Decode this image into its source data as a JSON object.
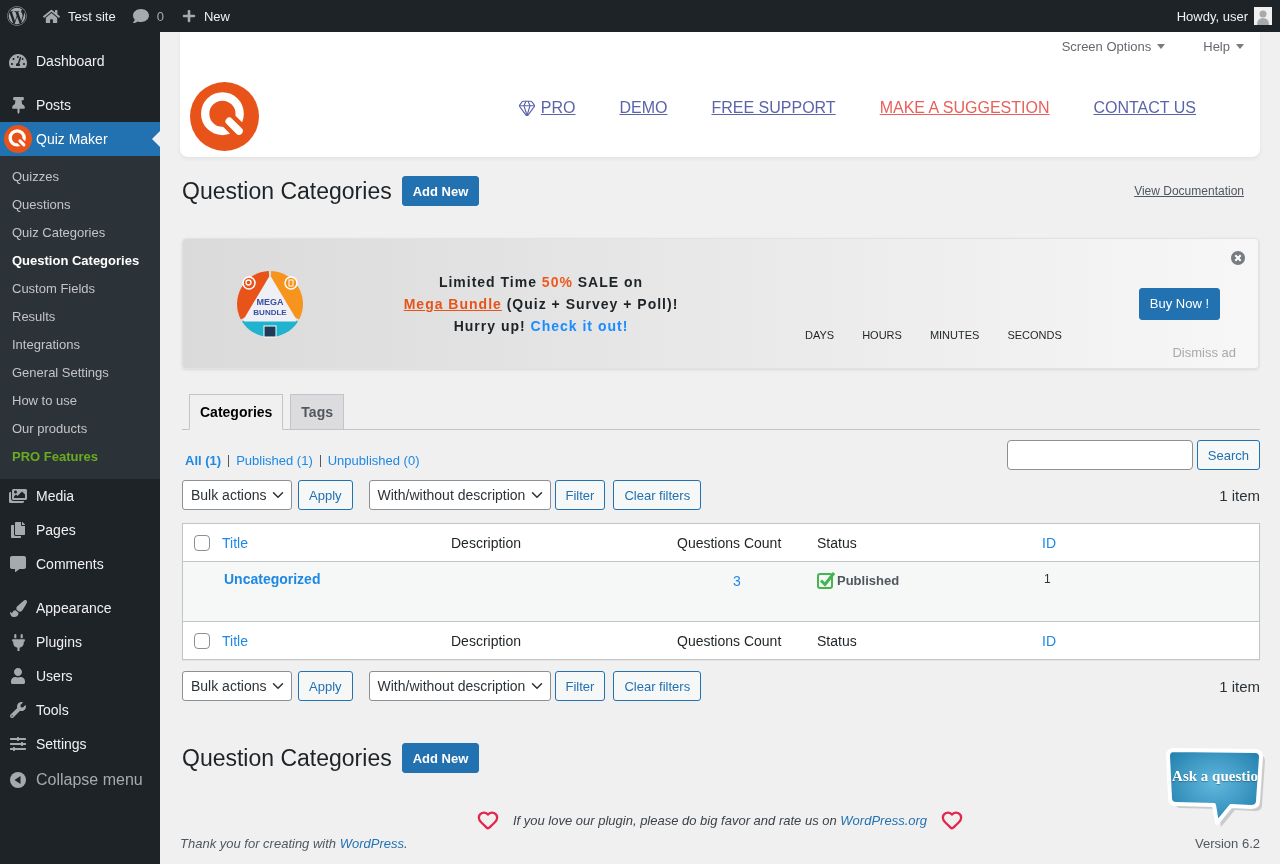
{
  "admin_bar": {
    "site_name": "Test site",
    "comment_count": "0",
    "new_label": "New",
    "greeting": "Howdy, user"
  },
  "sidebar": {
    "sections": [
      {
        "items": [
          {
            "label": "Dashboard",
            "selected": false
          }
        ]
      },
      {
        "items": [
          {
            "label": "Posts",
            "selected": false
          },
          {
            "label": "Quiz Maker",
            "selected": true,
            "children": [
              {
                "label": "Quizzes",
                "selected": false
              },
              {
                "label": "Questions",
                "selected": false
              },
              {
                "label": "Quiz Categories",
                "selected": false
              },
              {
                "label": "Question Categories",
                "selected": true
              },
              {
                "label": "Custom Fields",
                "selected": false
              },
              {
                "label": "Results",
                "selected": false
              },
              {
                "label": "Integrations",
                "selected": false
              },
              {
                "label": "General Settings",
                "selected": false
              },
              {
                "label": "How to use",
                "selected": false
              },
              {
                "label": "Our products",
                "selected": false
              },
              {
                "label": "PRO Features",
                "selected": false,
                "kind": "pro"
              }
            ]
          },
          {
            "label": "Media",
            "selected": false
          },
          {
            "label": "Pages",
            "selected": false
          },
          {
            "label": "Comments",
            "selected": false
          }
        ]
      },
      {
        "items": [
          {
            "label": "Appearance",
            "selected": false
          },
          {
            "label": "Plugins",
            "selected": false
          },
          {
            "label": "Users",
            "selected": false
          },
          {
            "label": "Tools",
            "selected": false
          },
          {
            "label": "Settings",
            "selected": false
          }
        ]
      }
    ],
    "collapse_label": "Collapse menu"
  },
  "screen_meta": [
    {
      "label": "Screen Options"
    },
    {
      "label": "Help"
    }
  ],
  "plugin_nav": [
    {
      "label": "PRO",
      "kind": "pro"
    },
    {
      "label": "DEMO",
      "kind": "link"
    },
    {
      "label": "FREE SUPPORT",
      "kind": "link"
    },
    {
      "label": "MAKE A SUGGESTION",
      "kind": "highlight"
    },
    {
      "label": "CONTACT US",
      "kind": "link"
    }
  ],
  "page_header": {
    "title": "Question Categories",
    "add_new": "Add New",
    "docs_link": "View Documentation"
  },
  "promo": {
    "badge_lines": [
      "MEGA",
      "BUNDLE"
    ],
    "message": [
      [
        {
          "text": "Limited Time ",
          "kind": "text"
        },
        {
          "text": "50%",
          "kind": "accent"
        },
        {
          "text": " SALE on",
          "kind": "text"
        }
      ],
      [
        {
          "text": "Mega Bundle",
          "kind": "link"
        },
        {
          "text": " (Quiz + Survey + Poll)!",
          "kind": "text"
        }
      ],
      [
        {
          "text": "Hurry up! ",
          "kind": "text"
        },
        {
          "text": "Check it out!",
          "kind": "cta"
        }
      ]
    ],
    "countdown": [
      "DAYS",
      "HOURS",
      "MINUTES",
      "SECONDS"
    ],
    "buy_button": "Buy Now !",
    "dismiss": "Dismiss ad"
  },
  "tabs": [
    {
      "label": "Categories",
      "selected": true
    },
    {
      "label": "Tags",
      "selected": false
    }
  ],
  "views": [
    {
      "label": "All (1)",
      "selected": true
    },
    {
      "label": "Published (1)",
      "selected": false
    },
    {
      "label": "Unpublished (0)",
      "selected": false
    }
  ],
  "search": {
    "button": "Search"
  },
  "tablenav_top": {
    "bulk_action": "Bulk actions",
    "apply": "Apply",
    "description_filter": "With/without description",
    "filter": "Filter",
    "clear_filters": "Clear filters",
    "count": "1 item"
  },
  "table": {
    "select_all": {
      "checked": false
    },
    "columns": [
      {
        "label": "Title",
        "sortable": true
      },
      {
        "label": "Description",
        "sortable": false
      },
      {
        "label": "Questions Count",
        "sortable": false
      },
      {
        "label": "Status",
        "sortable": false
      },
      {
        "label": "ID",
        "sortable": true
      }
    ],
    "rows": [
      {
        "title": "Uncategorized",
        "questions_count": "3",
        "status": "Published",
        "id": "1"
      }
    ],
    "footer_select_all": {
      "checked": false
    },
    "footer_columns": [
      {
        "label": "Title",
        "sortable": true
      },
      {
        "label": "Description",
        "sortable": false
      },
      {
        "label": "Questions Count",
        "sortable": false
      },
      {
        "label": "Status",
        "sortable": false
      },
      {
        "label": "ID",
        "sortable": true
      }
    ]
  },
  "tablenav_bottom": {
    "bulk_action": "Bulk actions",
    "apply": "Apply",
    "description_filter": "With/without description",
    "filter": "Filter",
    "clear_filters": "Clear filters",
    "count": "1 item"
  },
  "bottom_header": {
    "title": "Question Categories",
    "add_new": "Add New"
  },
  "footer": {
    "rating_note": "If you love our plugin, please do big favor and rate us on",
    "rating_link": "WordPress.org",
    "thanks": "Thank you for creating with",
    "thanks_link": "WordPress",
    "thanks_end": ".",
    "version": "Version 6.2"
  },
  "ask_widget": {
    "label": "Ask a questio"
  }
}
